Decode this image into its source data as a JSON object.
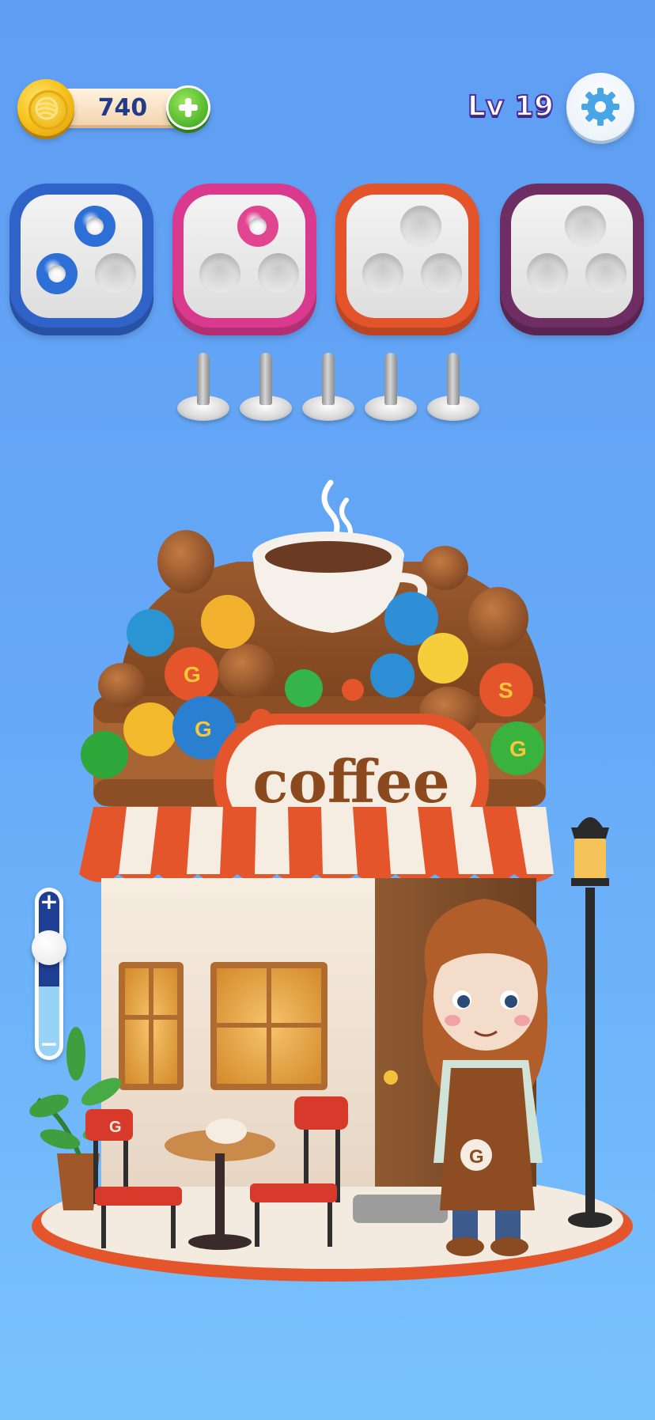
{
  "hud": {
    "coins": "740",
    "level": "Lv 19",
    "icons": {
      "coin": "yarn-coin-icon",
      "add": "plus-icon",
      "settings": "gear-icon"
    }
  },
  "trays": [
    {
      "name": "blue-tray",
      "color": "#2f63c8",
      "filled": 2,
      "capacity": 3,
      "yarn_color": "#2c6fd6"
    },
    {
      "name": "pink-tray",
      "color": "#d93a8e",
      "filled": 1,
      "capacity": 3,
      "yarn_color": "#e1458f"
    },
    {
      "name": "orange-tray",
      "color": "#e4542a",
      "filled": 0,
      "capacity": 3,
      "yarn_color": "#e4542a"
    },
    {
      "name": "purple-tray",
      "color": "#6e2d63",
      "filled": 0,
      "capacity": 3,
      "yarn_color": "#7a2f6b"
    }
  ],
  "pegs": {
    "count": 5,
    "filled": 0
  },
  "zoom": {
    "level": 0.6
  },
  "scene": {
    "sign_text": "coffee",
    "ball_letters": [
      "G",
      "G",
      "S",
      "G"
    ],
    "apron_letter": "G",
    "chair_letter": "G"
  }
}
